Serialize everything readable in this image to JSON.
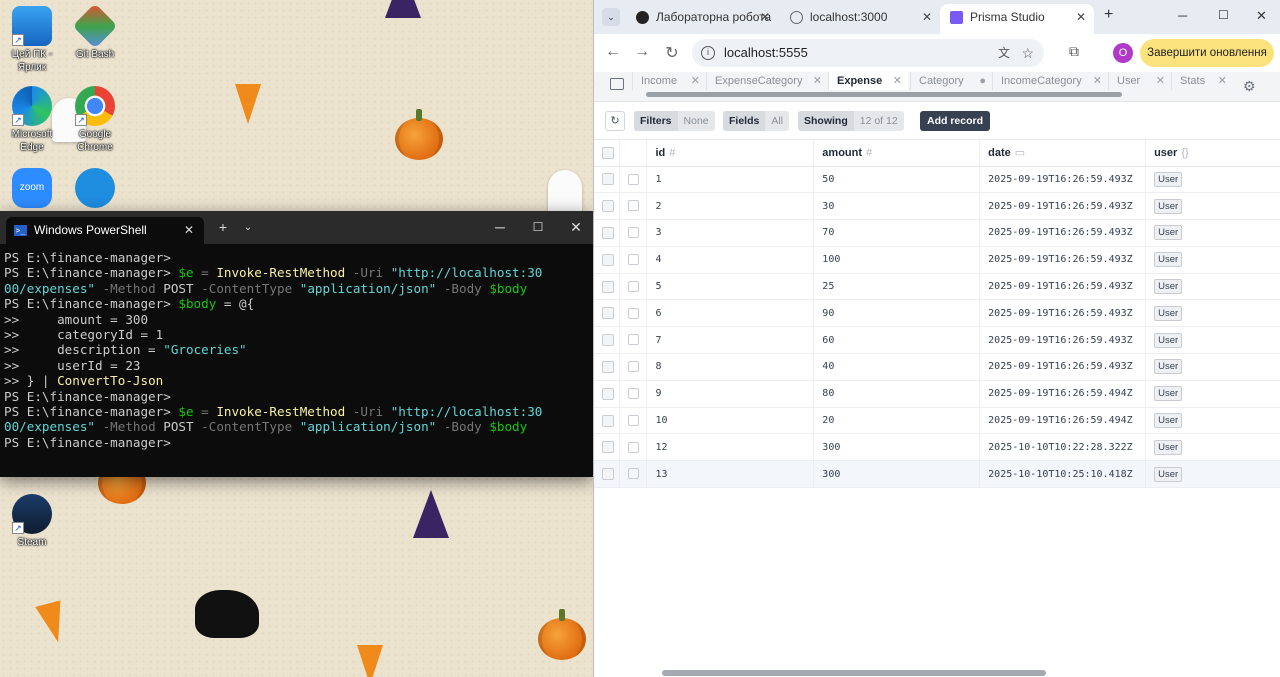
{
  "desktop": {
    "icons": [
      {
        "label": "Цей ПК - Ярлик",
        "icon": "computer-icon"
      },
      {
        "label": "Git Bash",
        "icon": "git-icon"
      },
      {
        "label": "Microsoft Edge",
        "icon": "edge-icon"
      },
      {
        "label": "Google Chrome",
        "icon": "chrome-icon"
      },
      {
        "label": "Zoom",
        "icon": "zoom-icon"
      },
      {
        "label": "",
        "icon": "app-icon"
      },
      {
        "label": "Steam",
        "icon": "steam-icon"
      }
    ]
  },
  "terminal": {
    "tab_title": "Windows PowerShell",
    "lines": {
      "l1": "PS E:\\finance-manager>",
      "l2_prompt": "PS E:\\finance-manager> ",
      "var_e": "$e",
      "eq": " = ",
      "cmd": "Invoke-RestMethod",
      "uri_param": " -Uri ",
      "url_a": "\"http://localhost:30",
      "url_b": "00/expenses\"",
      "method_param": " -Method ",
      "method_val": "POST",
      "ct_param": " -ContentType ",
      "ct_val": "\"application/json\"",
      "body_param": " -Body ",
      "body_var": "$body",
      "l4_prompt": "PS E:\\finance-manager> ",
      "l4_var": "$body",
      "l4_rest": " = @{",
      "l5": ">>     amount = 300",
      "l6": ">>     categoryId = 1",
      "l7a": ">>     description = ",
      "l7b": "\"Groceries\"",
      "l8": ">>     userId = 23",
      "l9a": ">> } | ",
      "l9b": "ConvertTo-Json",
      "l10": "PS E:\\finance-manager>",
      "l13": "PS E:\\finance-manager>"
    }
  },
  "browser": {
    "tabs": [
      {
        "title": "Лабораторна робота"
      },
      {
        "title": "localhost:3000"
      },
      {
        "title": "Prisma Studio"
      }
    ],
    "url": "localhost:5555",
    "update_button": "Завершити оновлення",
    "profile_initial": "O"
  },
  "prisma": {
    "model_tabs": [
      "Income",
      "ExpenseCategory",
      "Expense",
      "Category",
      "IncomeCategory",
      "User",
      "Stats"
    ],
    "active_model": "Expense",
    "toolbar": {
      "filters": "Filters",
      "filters_value": "None",
      "fields": "Fields",
      "fields_value": "All",
      "showing": "Showing",
      "showing_value": "12 of 12",
      "add_record": "Add record"
    },
    "columns": [
      {
        "name": "id",
        "type": "#"
      },
      {
        "name": "amount",
        "type": "#"
      },
      {
        "name": "date",
        "type": "▭"
      },
      {
        "name": "user",
        "type": "{}"
      }
    ],
    "rows": [
      {
        "id": "1",
        "amount": "50",
        "date": "2025-09-19T16:26:59.493Z",
        "user": "User"
      },
      {
        "id": "2",
        "amount": "30",
        "date": "2025-09-19T16:26:59.493Z",
        "user": "User"
      },
      {
        "id": "3",
        "amount": "70",
        "date": "2025-09-19T16:26:59.493Z",
        "user": "User"
      },
      {
        "id": "4",
        "amount": "100",
        "date": "2025-09-19T16:26:59.493Z",
        "user": "User"
      },
      {
        "id": "5",
        "amount": "25",
        "date": "2025-09-19T16:26:59.493Z",
        "user": "User"
      },
      {
        "id": "6",
        "amount": "90",
        "date": "2025-09-19T16:26:59.493Z",
        "user": "User"
      },
      {
        "id": "7",
        "amount": "60",
        "date": "2025-09-19T16:26:59.493Z",
        "user": "User"
      },
      {
        "id": "8",
        "amount": "40",
        "date": "2025-09-19T16:26:59.493Z",
        "user": "User"
      },
      {
        "id": "9",
        "amount": "80",
        "date": "2025-09-19T16:26:59.494Z",
        "user": "User"
      },
      {
        "id": "10",
        "amount": "20",
        "date": "2025-09-19T16:26:59.494Z",
        "user": "User"
      },
      {
        "id": "12",
        "amount": "300",
        "date": "2025-10-10T10:22:28.322Z",
        "user": "User"
      },
      {
        "id": "13",
        "amount": "300",
        "date": "2025-10-10T10:25:10.418Z",
        "user": "User"
      }
    ]
  }
}
